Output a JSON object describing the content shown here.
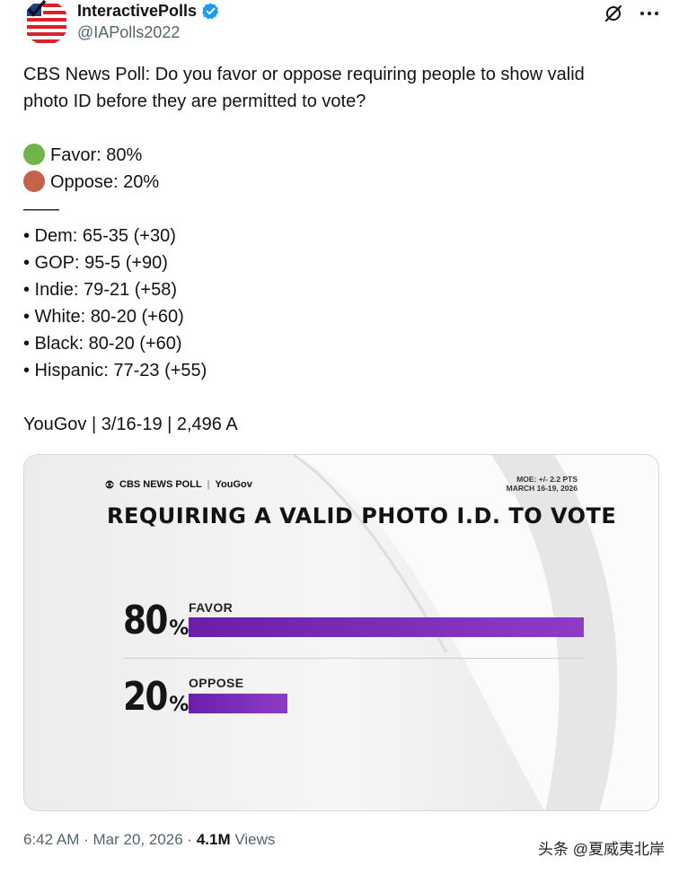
{
  "author": {
    "display_name": "InteractivePolls",
    "handle": "@IAPolls2022",
    "verified_color": "#1d9bf0"
  },
  "actions": {
    "grok_icon": "slash-circle-icon",
    "more_icon": "more-dots-icon"
  },
  "tweet": {
    "line1": "CBS News Poll: Do you favor or oppose requiring people to show valid",
    "line2": "photo ID before they are permitted to vote?",
    "favor": "Favor: 80%",
    "oppose": "Oppose: 20%",
    "favor_color": "#6fb54a",
    "oppose_color": "#c4624a",
    "separator": "——",
    "crosstabs": [
      "• Dem: 65-35 (+30)",
      "• GOP: 95-5 (+90)",
      "• Indie: 79-21 (+58)",
      "• White: 80-20 (+60)",
      "• Black: 80-20 (+60)",
      "• Hispanic: 77-23 (+55)"
    ],
    "source": "YouGov | 3/16-19 | 2,496 A"
  },
  "media": {
    "brand": "CBS NEWS POLL",
    "partner": "YouGov",
    "moe_line1": "MOE: +/- 2.2 PTS",
    "moe_line2": "MARCH 16-19, 2026",
    "title": "REQUIRING A VALID PHOTO I.D. TO VOTE",
    "bar_color": "#7b2cbf",
    "bars": [
      {
        "label": "FAVOR",
        "number": "80",
        "sign": "%",
        "value": 80
      },
      {
        "label": "OPPOSE",
        "number": "20",
        "sign": "%",
        "value": 20
      }
    ]
  },
  "footer": {
    "time": "6:42 AM",
    "date": "Mar 20, 2026",
    "views": "4.1M",
    "views_label": "Views",
    "watermark": "头条 @夏威夷北岸"
  }
}
